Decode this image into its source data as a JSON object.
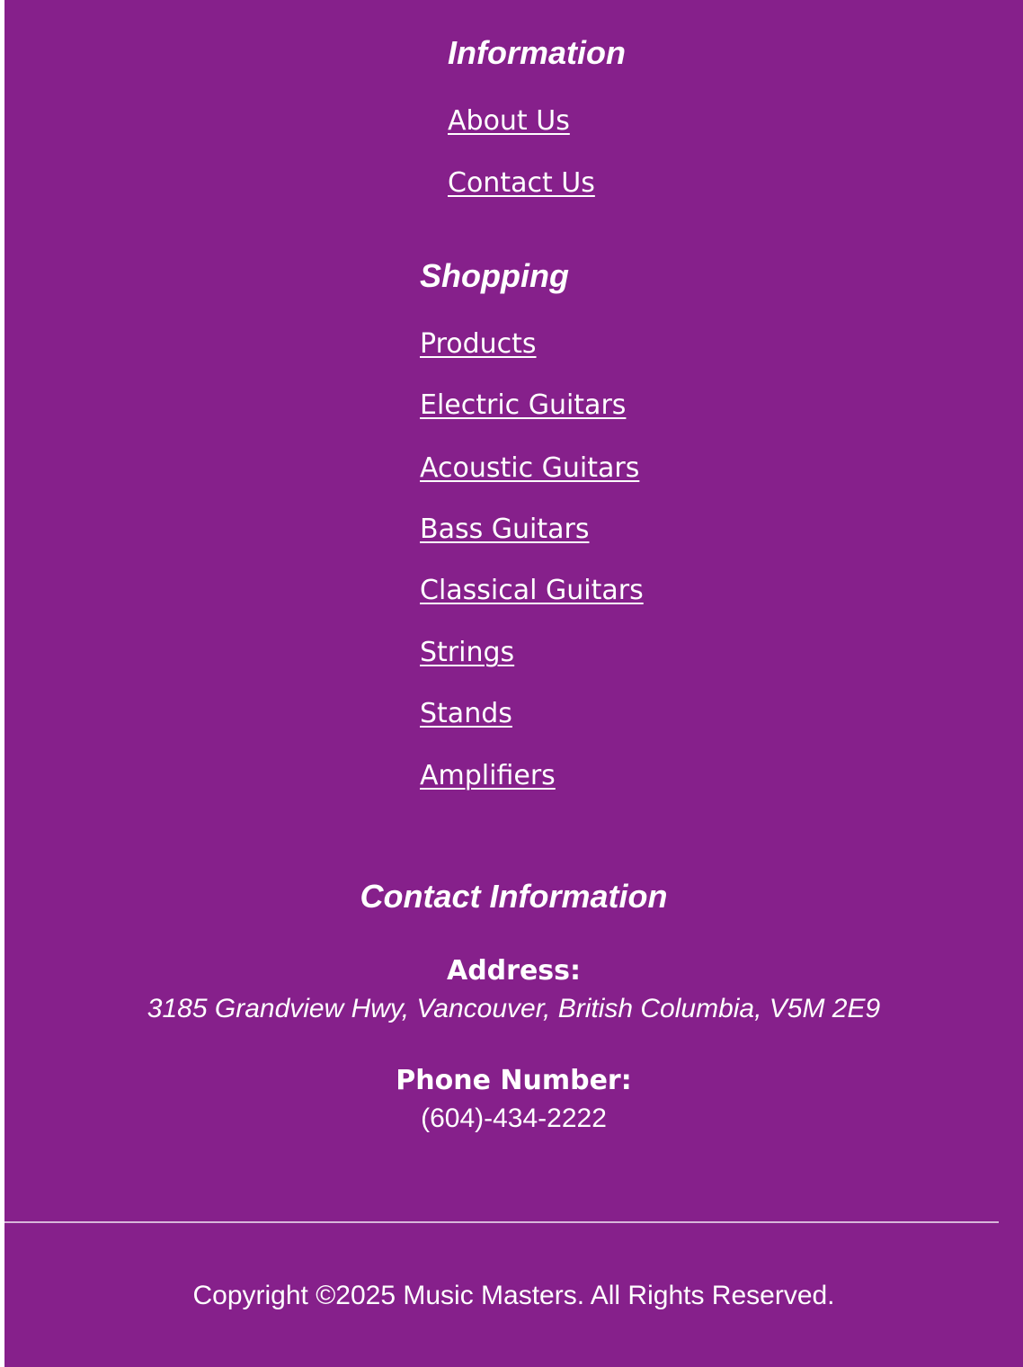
{
  "information": {
    "heading": "Information",
    "links": [
      "About Us",
      "Contact Us"
    ]
  },
  "shopping": {
    "heading": "Shopping",
    "links": [
      "Products",
      "Electric Guitars",
      "Acoustic Guitars",
      "Bass Guitars",
      "Classical Guitars",
      "Strings",
      "Stands",
      "Amplifiers"
    ]
  },
  "contact": {
    "heading": "Contact Information",
    "address_label": "Address:",
    "address": "3185 Grandview Hwy, Vancouver, British Columbia, V5M 2E9",
    "phone_label": "Phone Number:",
    "phone": "(604)-434-2222"
  },
  "copyright": "Copyright ©2025 Music Masters. All Rights Reserved.",
  "colors": {
    "background": "#86208b",
    "text": "#ffffff",
    "divider": "#d8b6da"
  }
}
